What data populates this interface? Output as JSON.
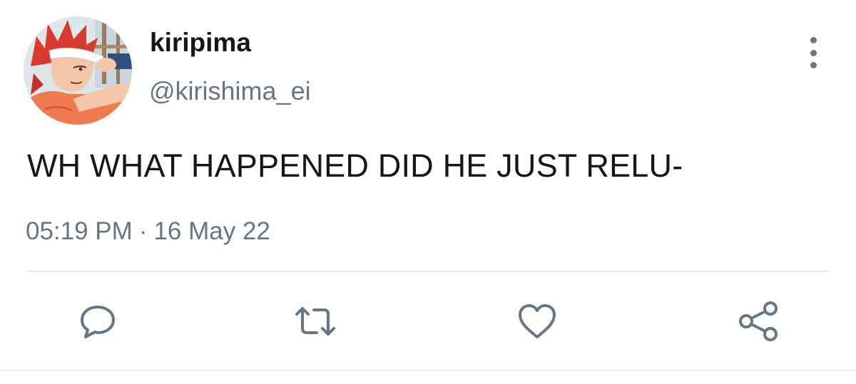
{
  "tweet": {
    "display_name": "kiripima",
    "handle": "@kirishima_ei",
    "text": "WH WHAT HAPPENED DID HE JUST RELU-",
    "time": "05:19 PM",
    "separator": "·",
    "date": "16 May 22"
  },
  "icons": {
    "avatar": "avatar-illustration",
    "more": "more-vertical-icon",
    "reply": "reply-icon",
    "retweet": "retweet-icon",
    "like": "heart-icon",
    "share": "share-icon"
  },
  "colors": {
    "text": "#14171a",
    "secondary": "#657786",
    "divider": "#e6ecf0"
  }
}
